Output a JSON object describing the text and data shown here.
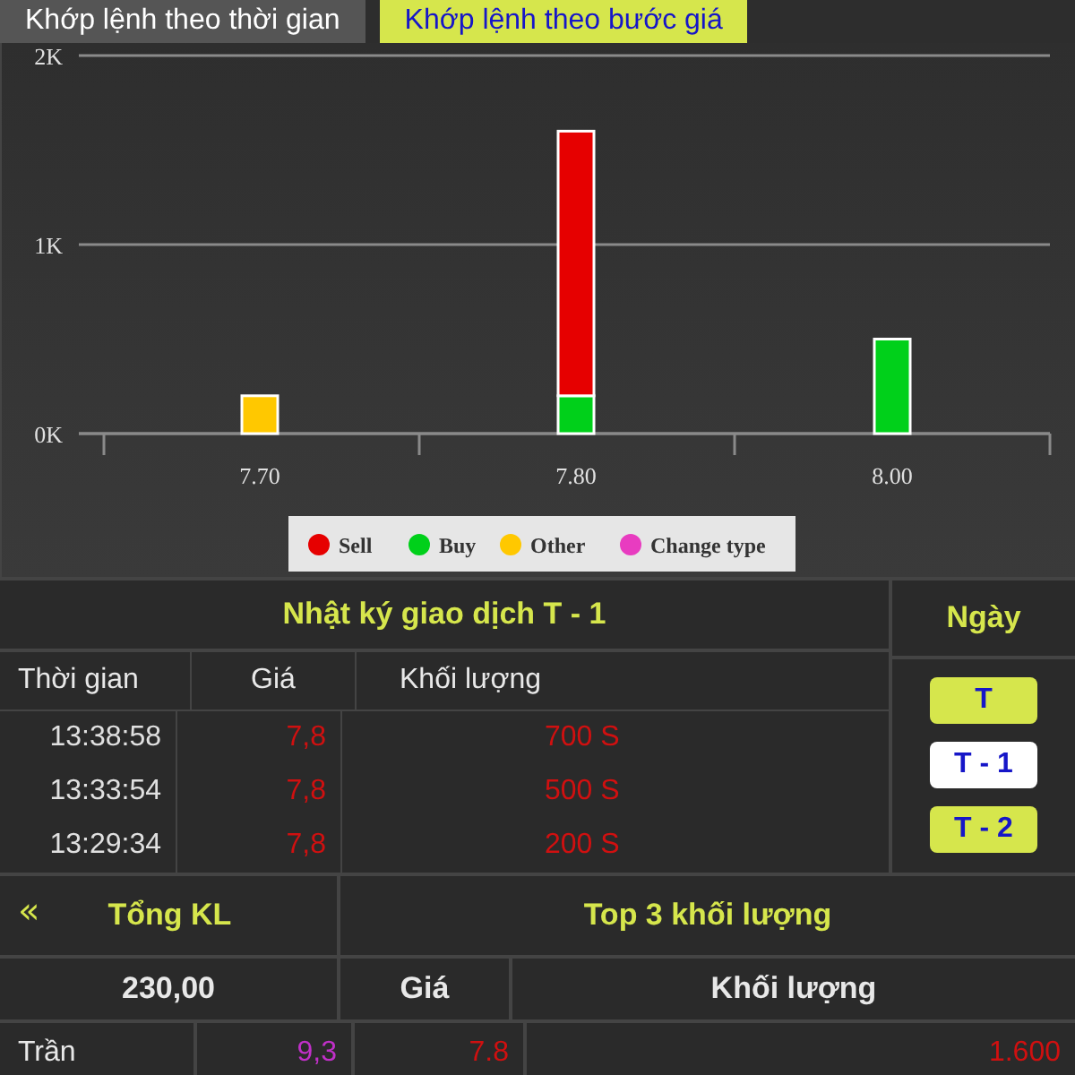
{
  "tabs": [
    {
      "label": "Khớp lệnh theo thời gian",
      "selected": false
    },
    {
      "label": "Khớp lệnh theo bước giá",
      "selected": true
    }
  ],
  "chart": {
    "chart_data": {
      "type": "bar",
      "stacked": true,
      "legend": "bottom",
      "categories": [
        "7.70",
        "7.80",
        "8.00"
      ],
      "ylim": [
        0,
        2000
      ],
      "yticks": [
        {
          "value": 0,
          "label": "0K"
        },
        {
          "value": 1000,
          "label": "1K"
        },
        {
          "value": 2000,
          "label": "2K"
        }
      ],
      "series": [
        {
          "name": "Sell",
          "color": "#e60000",
          "values": [
            0,
            1400,
            0
          ]
        },
        {
          "name": "Buy",
          "color": "#00d01a",
          "values": [
            0,
            200,
            500
          ]
        },
        {
          "name": "Other",
          "color": "#ffc800",
          "values": [
            200,
            0,
            0
          ]
        },
        {
          "name": "Change type",
          "color": "#e83cc0",
          "values": [
            0,
            0,
            0
          ]
        }
      ]
    }
  },
  "log": {
    "title": "Nhật ký giao dịch T - 1",
    "columns": [
      "Thời gian",
      "Giá",
      "Khối lượng"
    ],
    "rows": [
      {
        "time": "13:38:58",
        "price": "7,8",
        "volume": "700 S"
      },
      {
        "time": "13:33:54",
        "price": "7,8",
        "volume": "500 S"
      },
      {
        "time": "13:29:34",
        "price": "7,8",
        "volume": "200 S"
      }
    ]
  },
  "days": {
    "title": "Ngày",
    "items": [
      {
        "label": "T",
        "selected": false
      },
      {
        "label": "T - 1",
        "selected": true
      },
      {
        "label": "T - 2",
        "selected": false
      }
    ]
  },
  "summary": {
    "collapse": "«",
    "total_label": "Tổng KL",
    "top_title": "Top 3 khối lượng",
    "total_value": "230,00",
    "columns": [
      "Giá",
      "Khối lượng"
    ],
    "rows": [
      {
        "label": "Trần",
        "value": "9,3",
        "price": "7.8",
        "volume": "1.600"
      }
    ]
  }
}
